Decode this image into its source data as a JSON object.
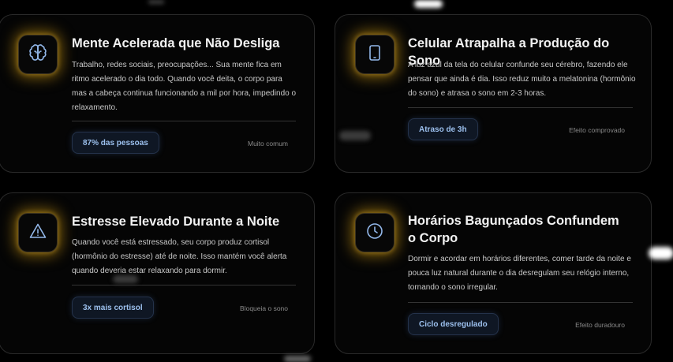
{
  "cards": [
    {
      "icon": "brain-icon",
      "title": "Mente Acelerada que Não Desliga",
      "description": "Trabalho, redes sociais, preocupações... Sua mente fica em ritmo acelerado o dia todo. Quando você deita, o corpo para mas a cabeça continua funcionando a mil por hora, impedindo o relaxamento.",
      "badge": "87% das pessoas",
      "meta": "Muito comum"
    },
    {
      "icon": "smartphone-icon",
      "title": "Celular Atrapalha a Produção do Sono",
      "description": "A luz azul da tela do celular confunde seu cérebro, fazendo ele pensar que ainda é dia. Isso reduz muito a melatonina (hormônio do sono) e atrasa o sono em 2-3 horas.",
      "badge": "Atraso de 3h",
      "meta": "Efeito comprovado"
    },
    {
      "icon": "warning-triangle-icon",
      "title": "Estresse Elevado Durante a Noite",
      "description": "Quando você está estressado, seu corpo produz cortisol (hormônio do estresse) até de noite. Isso mantém você alerta quando deveria estar relaxando para dormir.",
      "badge": "3x mais cortisol",
      "meta": "Bloqueia o sono"
    },
    {
      "icon": "clock-icon",
      "title": "Horários Bagunçados Confundem o Corpo",
      "description": "Dormir e acordar em horários diferentes, comer tarde da noite e pouca luz natural durante o dia desregulam seu relógio interno, tornando o sono irregular.",
      "badge": "Ciclo desregulado",
      "meta": "Efeito duradouro"
    }
  ],
  "colors": {
    "background": "#000000",
    "card": "#050505",
    "icon_glow": "#e6aa14",
    "icon_stroke": "#93b8ea",
    "badge_text": "#9cc0ee"
  }
}
